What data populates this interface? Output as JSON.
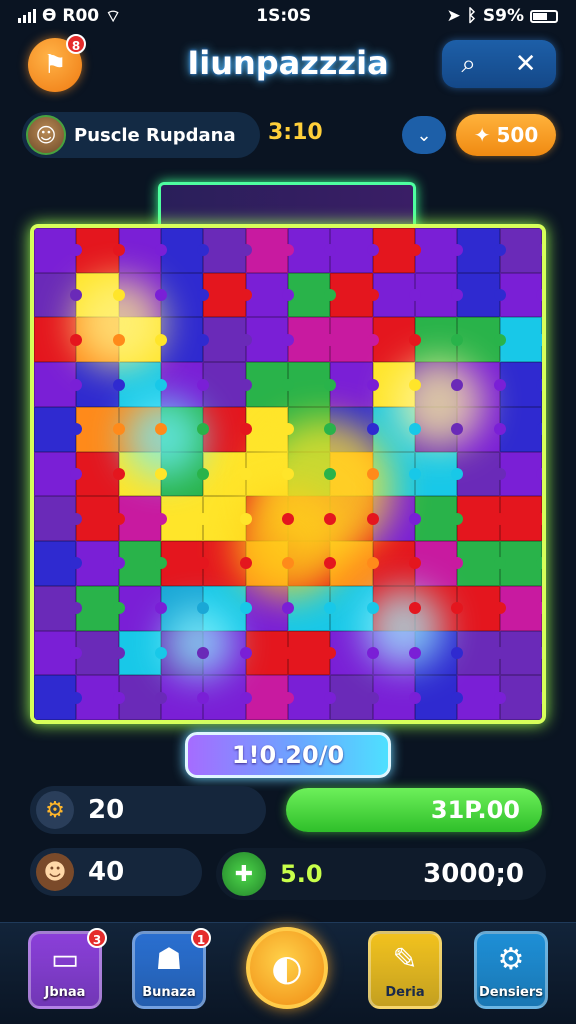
{
  "status_bar": {
    "carrier": "Ѳ R00",
    "time": "1S:0S",
    "battery": "S9%"
  },
  "header": {
    "title": "Iiunpazzzia",
    "flag_badge": "8"
  },
  "player": {
    "name": "Puscle Rupdana",
    "score": "3:10",
    "coins": "500"
  },
  "board": {
    "palette": [
      "#7a1fd6",
      "#2f2ad0",
      "#e4161e",
      "#29b34a",
      "#ffe52a",
      "#18c8e8",
      "#ff8a1a",
      "#1aa7d6",
      "#6a2ab8",
      "#c81aa0"
    ]
  },
  "progress": {
    "text": "1!0.20/0"
  },
  "stats": {
    "gear_value": "20",
    "green_bar_value": "31P.00",
    "creature_value": "40",
    "bonus_value": "5.0",
    "total_value": "3000;0"
  },
  "nav": {
    "items": [
      {
        "label": "Jbnaa",
        "badge": "3",
        "color": "#8b3fd9"
      },
      {
        "label": "Bunaza",
        "badge": "1",
        "color": "#2a6fd0"
      },
      {
        "label": "Deria",
        "badge": "",
        "color": "#f2c21e"
      },
      {
        "label": "Densiers",
        "badge": "",
        "color": "#1e8fd6"
      }
    ]
  }
}
